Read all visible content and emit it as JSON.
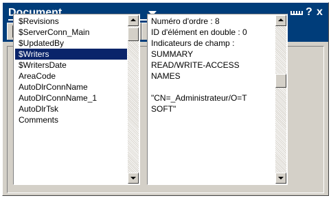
{
  "window": {
    "title": "Document",
    "help_label": "?",
    "close_label": "x"
  },
  "tabs": [
    {
      "icon": "document-info-icon"
    },
    {
      "icon": "field-properties-icon",
      "active": true
    },
    {
      "icon": "print-icon"
    },
    {
      "icon": "key-security-icon"
    },
    {
      "icon": "html-tags-icon",
      "label": "<+>"
    },
    {
      "icon": "hat-design-icon"
    }
  ],
  "field_list": {
    "items": [
      "$Revisions",
      "$ServerConn_Main",
      "$UpdatedBy",
      "$Writers",
      "$WritersDate",
      "AreaCode",
      "AutoDlrConnName",
      "AutoDlrConnName_1",
      "AutoDlrTsk",
      "Comments"
    ],
    "selected_index": 3
  },
  "field_info": {
    "lines": [
      "Numéro d'ordre : 8",
      "ID d'élément en double : 0",
      "Indicateurs de champ :",
      "SUMMARY",
      "READ/WRITE-ACCESS",
      "NAMES",
      "",
      "\"CN=_Administrateur/O=T",
      "SOFT\""
    ]
  },
  "colors": {
    "titlebar": "#003d7a",
    "selection": "#0a246a",
    "face": "#d4d0c8"
  }
}
